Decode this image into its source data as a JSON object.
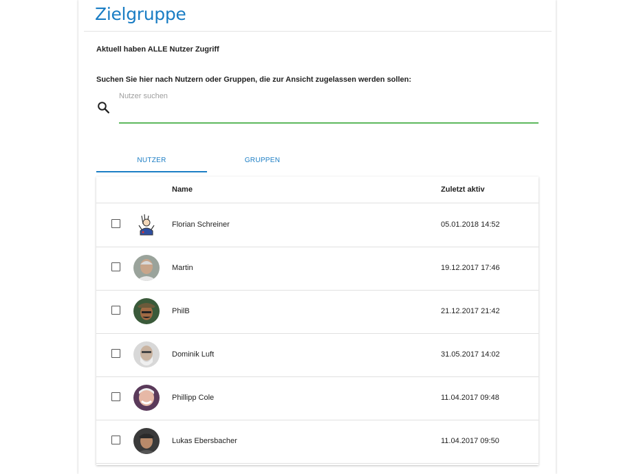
{
  "title": "Zielgruppe",
  "access_info": "Aktuell haben ALLE Nutzer Zugriff",
  "search": {
    "label": "Suchen Sie hier nach Nutzern oder Gruppen, die zur Ansicht zugelassen werden sollen:",
    "placeholder": "Nutzer suchen",
    "icon": "search-icon"
  },
  "tabs": [
    {
      "label": "NUTZER",
      "active": true
    },
    {
      "label": "GRUPPEN",
      "active": false
    }
  ],
  "table": {
    "columns": {
      "name": "Name",
      "last_active": "Zuletzt aktiv"
    },
    "rows": [
      {
        "name": "Florian Schreiner",
        "last_active": "05.01.2018 14:52"
      },
      {
        "name": "Martin",
        "last_active": "19.12.2017 17:46"
      },
      {
        "name": "PhilB",
        "last_active": "21.12.2017 21:42"
      },
      {
        "name": "Dominik Luft",
        "last_active": "31.05.2017 14:02"
      },
      {
        "name": "Phillipp Cole",
        "last_active": "11.04.2017 09:48"
      },
      {
        "name": "Lukas Ebersbacher",
        "last_active": "11.04.2017 09:50"
      }
    ]
  },
  "colors": {
    "accent": "#1a7dc4",
    "search_underline": "#5cb85c"
  }
}
